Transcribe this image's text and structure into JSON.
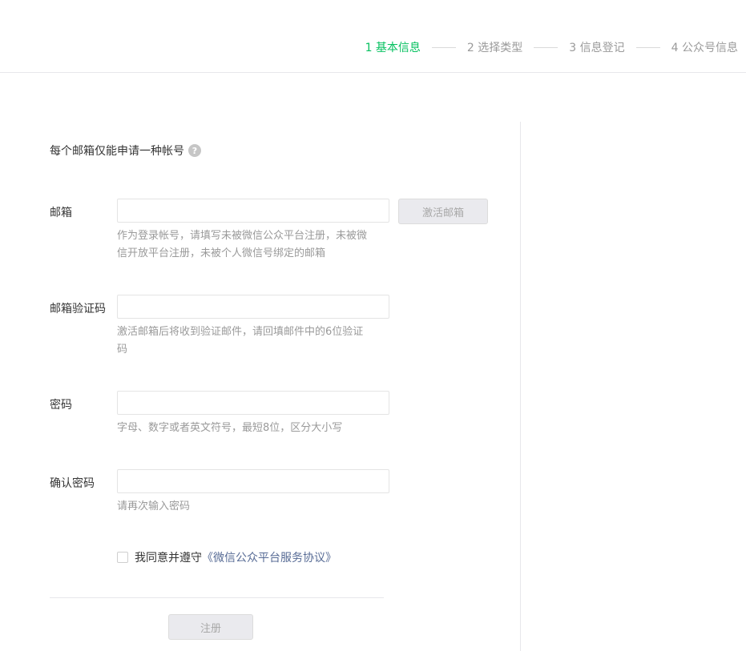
{
  "steps": [
    {
      "label": "1 基本信息",
      "active": true
    },
    {
      "label": "2 选择类型",
      "active": false
    },
    {
      "label": "3 信息登记",
      "active": false
    },
    {
      "label": "4 公众号信息",
      "active": false
    }
  ],
  "notice": {
    "text": "每个邮箱仅能申请一种帐号",
    "help_icon": "?"
  },
  "form": {
    "email": {
      "label": "邮箱",
      "value": "",
      "placeholder": "",
      "tip": "作为登录帐号，请填写未被微信公众平台注册，未被微信开放平台注册，未被个人微信号绑定的邮箱",
      "activate_label": "激活邮箱"
    },
    "code": {
      "label": "邮箱验证码",
      "value": "",
      "placeholder": "",
      "tip": "激活邮箱后将收到验证邮件，请回填邮件中的6位验证码"
    },
    "password": {
      "label": "密码",
      "value": "",
      "placeholder": "",
      "tip": "字母、数字或者英文符号，最短8位，区分大小写"
    },
    "confirm": {
      "label": "确认密码",
      "value": "",
      "placeholder": "",
      "tip": "请再次输入密码"
    },
    "agree": {
      "text": "我同意并遵守",
      "link": "《微信公众平台服务协议》",
      "checked": false
    },
    "submit_label": "注册"
  },
  "colors": {
    "accent": "#07c160",
    "link": "#576b95",
    "tip": "#9a9a9a"
  }
}
